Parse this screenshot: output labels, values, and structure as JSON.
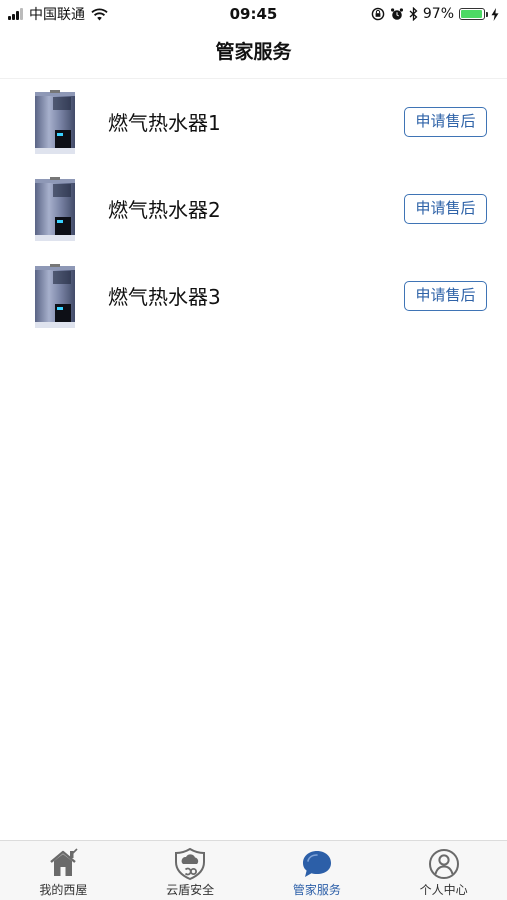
{
  "status_bar": {
    "carrier": "中国联通",
    "time": "09:45",
    "battery_text": "97%",
    "battery_level": 0.97,
    "battery_color": "#4cd964",
    "icons": [
      "signal-icon",
      "wifi-icon",
      "rotation-lock-icon",
      "alarm-icon",
      "bluetooth-icon",
      "battery-icon",
      "charging-icon"
    ]
  },
  "nav": {
    "title": "管家服务"
  },
  "devices": [
    {
      "name": "燃气热水器1",
      "action": "申请售后",
      "icon": "water-heater-icon"
    },
    {
      "name": "燃气热水器2",
      "action": "申请售后",
      "icon": "water-heater-icon"
    },
    {
      "name": "燃气热水器3",
      "action": "申请售后",
      "icon": "water-heater-icon"
    }
  ],
  "tabs": [
    {
      "label": "我的西屋",
      "icon": "home-icon",
      "active": false
    },
    {
      "label": "云盾安全",
      "icon": "cloud-shield-icon",
      "active": false
    },
    {
      "label": "管家服务",
      "icon": "chat-bubble-icon",
      "active": true
    },
    {
      "label": "个人中心",
      "icon": "user-icon",
      "active": false
    }
  ],
  "colors": {
    "accent": "#2c5fa8",
    "button_border": "#3f74b5",
    "tab_inactive": "#666666"
  }
}
